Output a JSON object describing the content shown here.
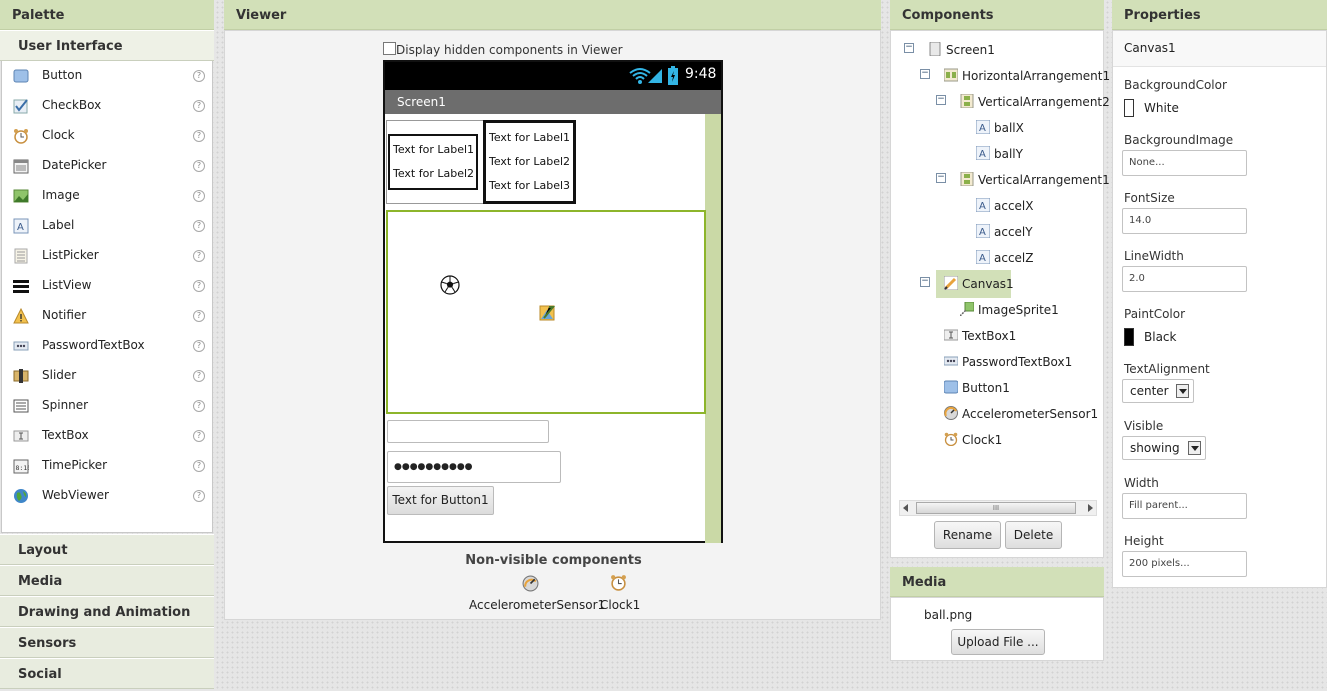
{
  "palette": {
    "title": "Palette",
    "active_category": "User Interface",
    "items": [
      {
        "label": "Button",
        "icon": "button-icon"
      },
      {
        "label": "CheckBox",
        "icon": "checkbox-icon"
      },
      {
        "label": "Clock",
        "icon": "clock-icon"
      },
      {
        "label": "DatePicker",
        "icon": "datepicker-icon"
      },
      {
        "label": "Image",
        "icon": "image-icon"
      },
      {
        "label": "Label",
        "icon": "label-icon"
      },
      {
        "label": "ListPicker",
        "icon": "listpicker-icon"
      },
      {
        "label": "ListView",
        "icon": "listview-icon"
      },
      {
        "label": "Notifier",
        "icon": "notifier-icon"
      },
      {
        "label": "PasswordTextBox",
        "icon": "passwordtextbox-icon"
      },
      {
        "label": "Slider",
        "icon": "slider-icon"
      },
      {
        "label": "Spinner",
        "icon": "spinner-icon"
      },
      {
        "label": "TextBox",
        "icon": "textbox-icon"
      },
      {
        "label": "TimePicker",
        "icon": "timepicker-icon"
      },
      {
        "label": "WebViewer",
        "icon": "webviewer-icon"
      }
    ],
    "help_glyph": "?",
    "categories": [
      "Layout",
      "Media",
      "Drawing and Animation",
      "Sensors",
      "Social"
    ]
  },
  "viewer": {
    "title": "Viewer",
    "hidden_checkbox_label": "Display hidden components in Viewer",
    "status_time": "9:48",
    "screen_title": "Screen1",
    "va2_labels": [
      "Text for Label1",
      "Text for Label2"
    ],
    "va1_labels": [
      "Text for Label1",
      "Text for Label2",
      "Text for Label3"
    ],
    "password_dots": "●●●●●●●●●●",
    "button_text": "Text for Button1",
    "nonvisible_title": "Non-visible components",
    "nonvisible": [
      "AccelerometerSensor1",
      "Clock1"
    ]
  },
  "components": {
    "title": "Components",
    "tree": [
      "Screen1",
      "HorizontalArrangement1",
      "VerticalArrangement2",
      "ballX",
      "ballY",
      "VerticalArrangement1",
      "accelX",
      "accelY",
      "accelZ",
      "Canvas1",
      "ImageSprite1",
      "TextBox1",
      "PasswordTextBox1",
      "Button1",
      "AccelerometerSensor1",
      "Clock1"
    ],
    "collapse_glyph": "−",
    "scroll_grip": "III",
    "rename_label": "Rename",
    "delete_label": "Delete"
  },
  "media": {
    "title": "Media",
    "file": "ball.png",
    "upload_label": "Upload File ..."
  },
  "properties": {
    "title": "Properties",
    "component": "Canvas1",
    "background_color_label": "BackgroundColor",
    "background_color_value": "White",
    "background_image_label": "BackgroundImage",
    "background_image_value": "None...",
    "font_size_label": "FontSize",
    "font_size_value": "14.0",
    "line_width_label": "LineWidth",
    "line_width_value": "2.0",
    "paint_color_label": "PaintColor",
    "paint_color_value": "Black",
    "text_alignment_label": "TextAlignment",
    "text_alignment_value": "center",
    "visible_label": "Visible",
    "visible_value": "showing",
    "width_label": "Width",
    "width_value": "Fill parent...",
    "height_label": "Height",
    "height_value": "200 pixels..."
  },
  "colors": {
    "header_bg": "#d2e0b8",
    "canvas_border": "#8db52b",
    "selected_bg": "#d2e0b8"
  }
}
